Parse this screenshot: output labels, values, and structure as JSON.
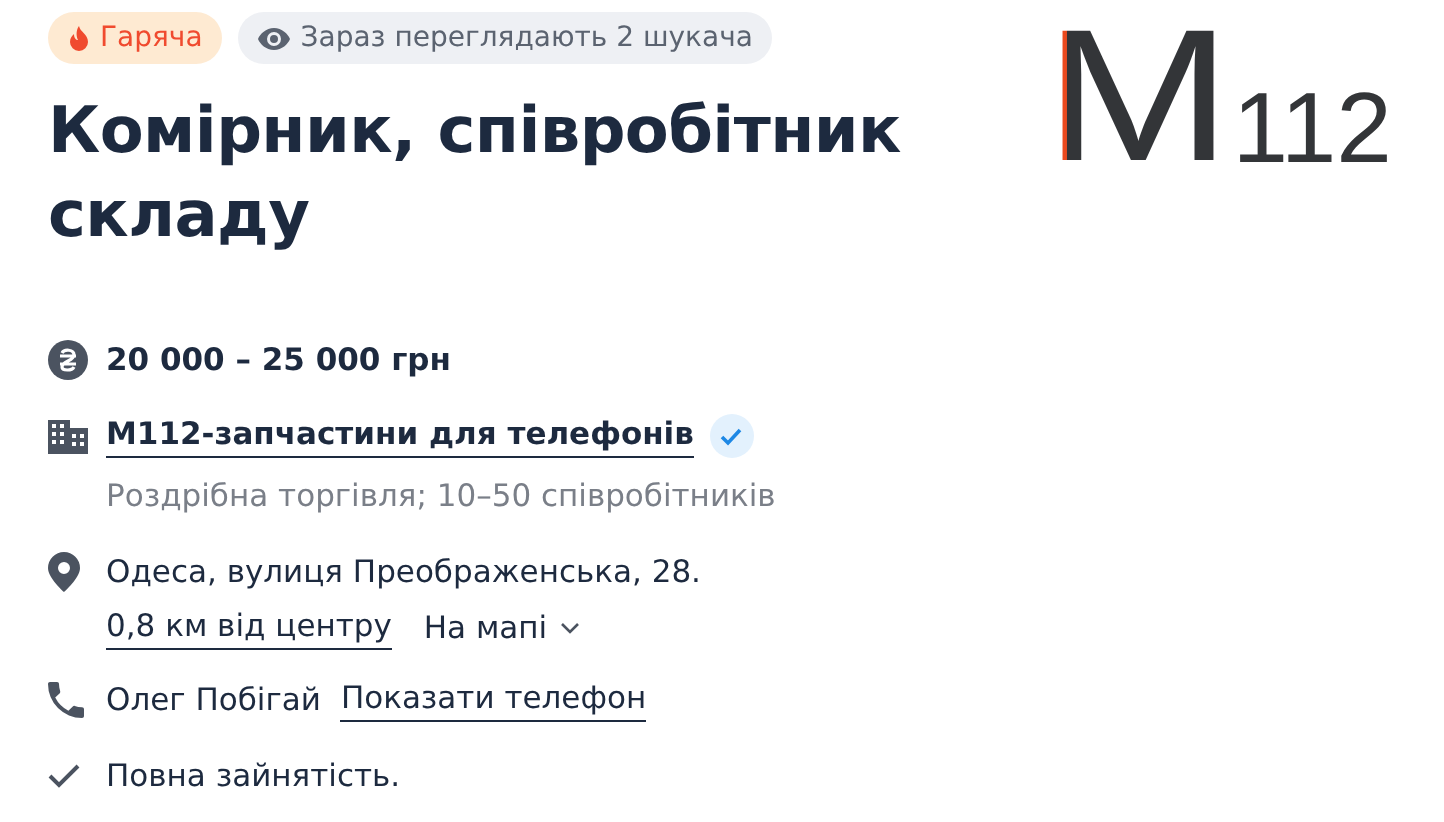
{
  "badges": [
    {
      "kind": "hot",
      "label": "Гаряча"
    },
    {
      "kind": "views",
      "label": "Зараз переглядають 2 шукача"
    }
  ],
  "logo": {
    "mark": "M",
    "number": "112"
  },
  "title": "Комірник, співробітник складу",
  "salary": "20 000 – 25 000 грн",
  "company": {
    "name": "М112-запчастини для телефонів",
    "verified": true,
    "details": "Роздрібна торгівля; 10–50 співробітників"
  },
  "location": {
    "address": "Одеса, вулиця Преображенська, 28.",
    "distance": "0,8 км від центру",
    "map_link": "На мапі"
  },
  "contact": {
    "name": "Олег Побігай",
    "phone_link": "Показати телефон"
  },
  "employment": "Повна зайнятість."
}
